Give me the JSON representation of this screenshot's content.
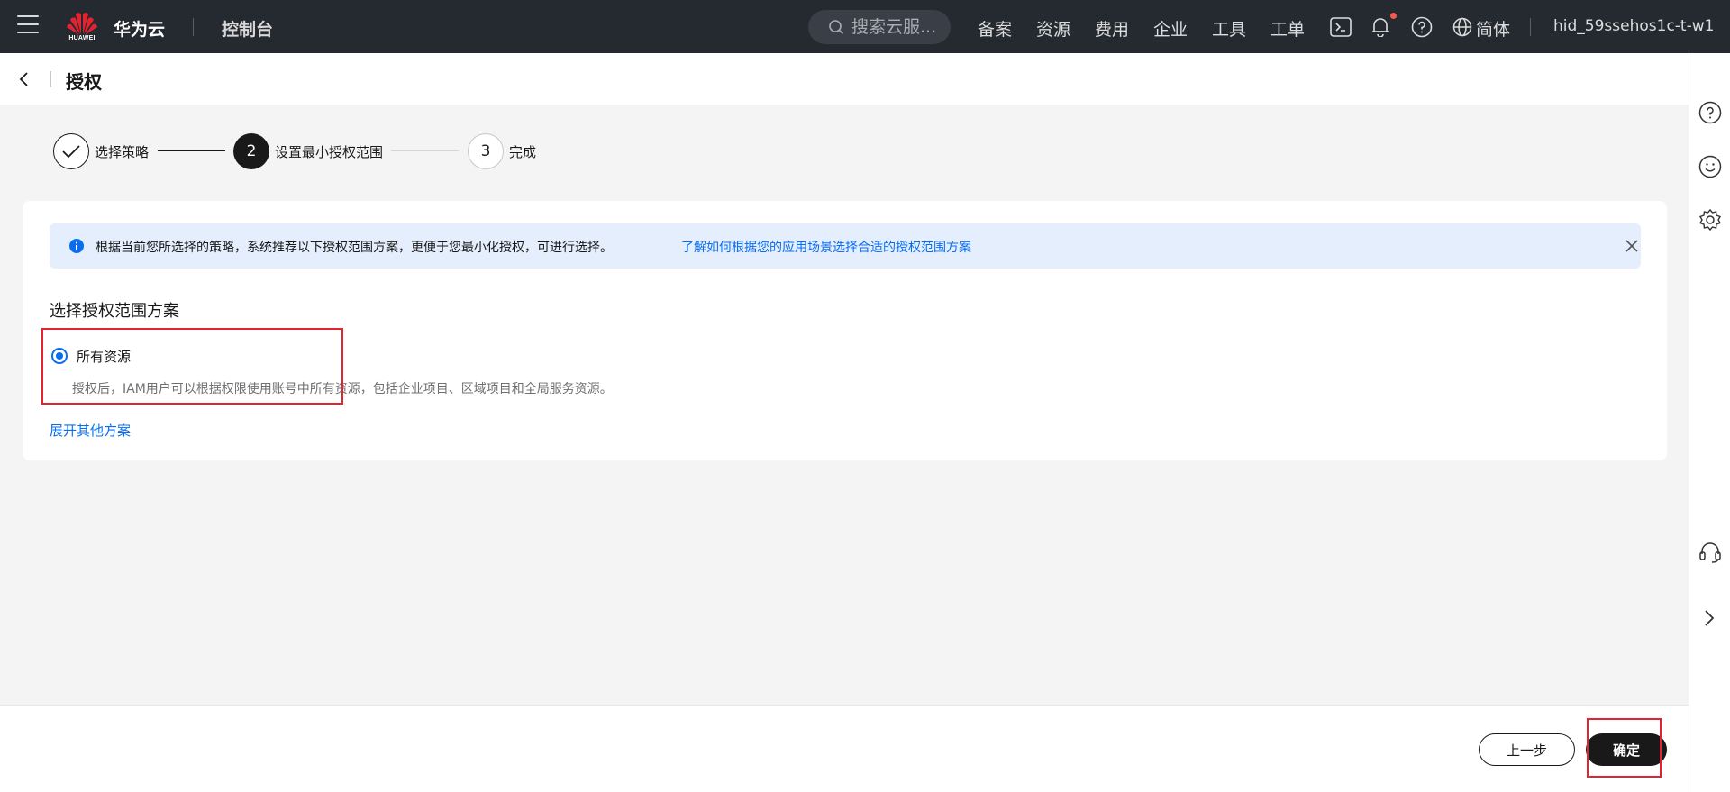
{
  "topbar": {
    "brand": "华为云",
    "logo_text": "HUAWEI",
    "console": "控制台",
    "search_placeholder": "搜索云服...",
    "nav_links": [
      "备案",
      "资源",
      "费用",
      "企业",
      "工具",
      "工单"
    ],
    "language": "简体",
    "user": "hid_59ssehos1c-t-w1"
  },
  "titlebar": {
    "title": "授权"
  },
  "steps": [
    {
      "number": "1",
      "label": "选择策略",
      "state": "done"
    },
    {
      "number": "2",
      "label": "设置最小授权范围",
      "state": "active"
    },
    {
      "number": "3",
      "label": "完成",
      "state": "pending"
    }
  ],
  "notice": {
    "text": "根据当前您所选择的策略，系统推荐以下授权范围方案，更便于您最小化授权，可进行选择。",
    "link": "了解如何根据您的应用场景选择合适的授权范围方案"
  },
  "section": {
    "title": "选择授权范围方案",
    "option_label": "所有资源",
    "option_desc": "授权后，IAM用户可以根据权限使用账号中所有资源，包括企业项目、区域项目和全局服务资源。",
    "expand_link": "展开其他方案"
  },
  "footer": {
    "prev_label": "上一步",
    "ok_label": "确定"
  },
  "colors": {
    "accent": "#0a6df0",
    "nav_bg": "#252a31",
    "highlight": "#e3232f"
  }
}
